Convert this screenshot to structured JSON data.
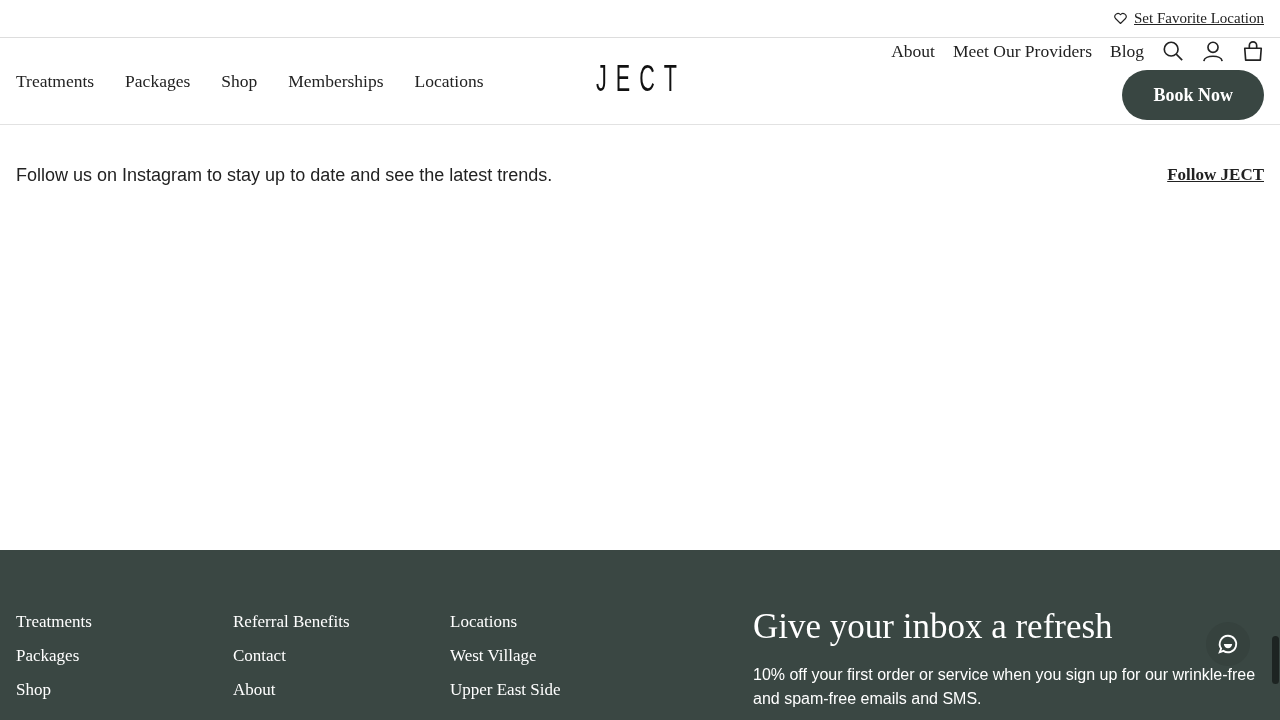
{
  "top_bar": {
    "favorite_link": "Set Favorite Location"
  },
  "header": {
    "main_nav": [
      "Treatments",
      "Packages",
      "Shop",
      "Memberships",
      "Locations"
    ],
    "logo": "JECT",
    "secondary_nav": [
      "About",
      "Meet Our Providers",
      "Blog"
    ],
    "book_button": "Book Now"
  },
  "instagram": {
    "text": "Follow us on Instagram to stay up to date and see the latest trends.",
    "follow_link": "Follow JECT"
  },
  "footer": {
    "columns": [
      [
        "Treatments",
        "Packages",
        "Shop"
      ],
      [
        "Referral Benefits",
        "Contact",
        "About"
      ],
      [
        "Locations",
        "West Village",
        "Upper East Side"
      ]
    ],
    "newsletter_title": "Give your inbox a refresh",
    "newsletter_text": "10% off your first order or service when you sign up for our wrinkle-free and spam-free emails and SMS."
  }
}
